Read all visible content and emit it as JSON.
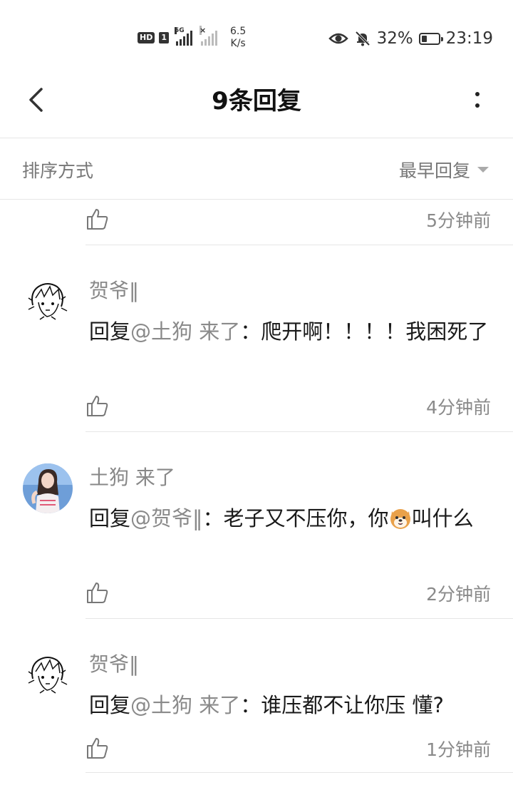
{
  "status_bar": {
    "hd": "HD",
    "sim": "1",
    "network": "5G",
    "net_speed_value": "6.5",
    "net_speed_unit": "K/s",
    "battery_pct": "32%",
    "battery_level": 0.32,
    "time": "23:19"
  },
  "nav": {
    "title": "9条回复"
  },
  "sort": {
    "label": "排序方式",
    "value": "最早回复"
  },
  "first_timestamp": "5分钟前",
  "comments": [
    {
      "author": "贺爷‖",
      "prefix": "回复",
      "mention": "@土狗 来了",
      "separator": "：",
      "text": "爬开啊！！！！我困死了",
      "timestamp": "4分钟前",
      "avatar": "sketch-avatar"
    },
    {
      "author": "土狗 来了",
      "prefix": "回复",
      "mention": "@贺爷‖",
      "separator": "：",
      "text_before": "老子又不压你，你",
      "emoji": "dog-emoji",
      "text_after": "叫什么",
      "timestamp": "2分钟前",
      "avatar": "girl-avatar"
    },
    {
      "author": "贺爷‖",
      "prefix": "回复",
      "mention": "@土狗 来了",
      "separator": "：",
      "text": "谁压都不让你压 懂?",
      "timestamp": "1分钟前",
      "avatar": "sketch-avatar"
    }
  ],
  "colors": {
    "text_primary": "#1a1a1a",
    "text_secondary": "#888888",
    "divider": "#e6e6e6",
    "background": "#ffffff"
  }
}
